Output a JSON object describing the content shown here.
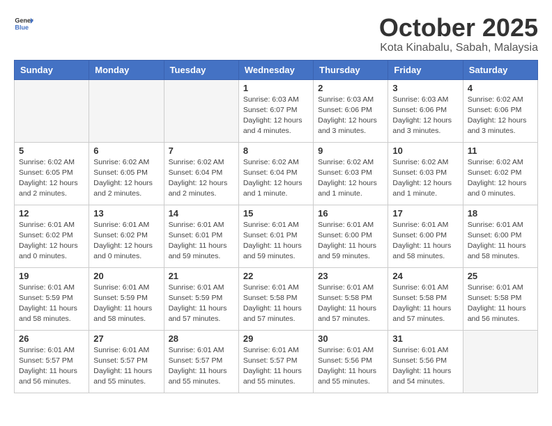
{
  "header": {
    "logo_general": "General",
    "logo_blue": "Blue",
    "month_title": "October 2025",
    "subtitle": "Kota Kinabalu, Sabah, Malaysia"
  },
  "weekdays": [
    "Sunday",
    "Monday",
    "Tuesday",
    "Wednesday",
    "Thursday",
    "Friday",
    "Saturday"
  ],
  "weeks": [
    [
      {
        "day": "",
        "info": ""
      },
      {
        "day": "",
        "info": ""
      },
      {
        "day": "",
        "info": ""
      },
      {
        "day": "1",
        "info": "Sunrise: 6:03 AM\nSunset: 6:07 PM\nDaylight: 12 hours\nand 4 minutes."
      },
      {
        "day": "2",
        "info": "Sunrise: 6:03 AM\nSunset: 6:06 PM\nDaylight: 12 hours\nand 3 minutes."
      },
      {
        "day": "3",
        "info": "Sunrise: 6:03 AM\nSunset: 6:06 PM\nDaylight: 12 hours\nand 3 minutes."
      },
      {
        "day": "4",
        "info": "Sunrise: 6:02 AM\nSunset: 6:06 PM\nDaylight: 12 hours\nand 3 minutes."
      }
    ],
    [
      {
        "day": "5",
        "info": "Sunrise: 6:02 AM\nSunset: 6:05 PM\nDaylight: 12 hours\nand 2 minutes."
      },
      {
        "day": "6",
        "info": "Sunrise: 6:02 AM\nSunset: 6:05 PM\nDaylight: 12 hours\nand 2 minutes."
      },
      {
        "day": "7",
        "info": "Sunrise: 6:02 AM\nSunset: 6:04 PM\nDaylight: 12 hours\nand 2 minutes."
      },
      {
        "day": "8",
        "info": "Sunrise: 6:02 AM\nSunset: 6:04 PM\nDaylight: 12 hours\nand 1 minute."
      },
      {
        "day": "9",
        "info": "Sunrise: 6:02 AM\nSunset: 6:03 PM\nDaylight: 12 hours\nand 1 minute."
      },
      {
        "day": "10",
        "info": "Sunrise: 6:02 AM\nSunset: 6:03 PM\nDaylight: 12 hours\nand 1 minute."
      },
      {
        "day": "11",
        "info": "Sunrise: 6:02 AM\nSunset: 6:02 PM\nDaylight: 12 hours\nand 0 minutes."
      }
    ],
    [
      {
        "day": "12",
        "info": "Sunrise: 6:01 AM\nSunset: 6:02 PM\nDaylight: 12 hours\nand 0 minutes."
      },
      {
        "day": "13",
        "info": "Sunrise: 6:01 AM\nSunset: 6:02 PM\nDaylight: 12 hours\nand 0 minutes."
      },
      {
        "day": "14",
        "info": "Sunrise: 6:01 AM\nSunset: 6:01 PM\nDaylight: 11 hours\nand 59 minutes."
      },
      {
        "day": "15",
        "info": "Sunrise: 6:01 AM\nSunset: 6:01 PM\nDaylight: 11 hours\nand 59 minutes."
      },
      {
        "day": "16",
        "info": "Sunrise: 6:01 AM\nSunset: 6:00 PM\nDaylight: 11 hours\nand 59 minutes."
      },
      {
        "day": "17",
        "info": "Sunrise: 6:01 AM\nSunset: 6:00 PM\nDaylight: 11 hours\nand 58 minutes."
      },
      {
        "day": "18",
        "info": "Sunrise: 6:01 AM\nSunset: 6:00 PM\nDaylight: 11 hours\nand 58 minutes."
      }
    ],
    [
      {
        "day": "19",
        "info": "Sunrise: 6:01 AM\nSunset: 5:59 PM\nDaylight: 11 hours\nand 58 minutes."
      },
      {
        "day": "20",
        "info": "Sunrise: 6:01 AM\nSunset: 5:59 PM\nDaylight: 11 hours\nand 58 minutes."
      },
      {
        "day": "21",
        "info": "Sunrise: 6:01 AM\nSunset: 5:59 PM\nDaylight: 11 hours\nand 57 minutes."
      },
      {
        "day": "22",
        "info": "Sunrise: 6:01 AM\nSunset: 5:58 PM\nDaylight: 11 hours\nand 57 minutes."
      },
      {
        "day": "23",
        "info": "Sunrise: 6:01 AM\nSunset: 5:58 PM\nDaylight: 11 hours\nand 57 minutes."
      },
      {
        "day": "24",
        "info": "Sunrise: 6:01 AM\nSunset: 5:58 PM\nDaylight: 11 hours\nand 57 minutes."
      },
      {
        "day": "25",
        "info": "Sunrise: 6:01 AM\nSunset: 5:58 PM\nDaylight: 11 hours\nand 56 minutes."
      }
    ],
    [
      {
        "day": "26",
        "info": "Sunrise: 6:01 AM\nSunset: 5:57 PM\nDaylight: 11 hours\nand 56 minutes."
      },
      {
        "day": "27",
        "info": "Sunrise: 6:01 AM\nSunset: 5:57 PM\nDaylight: 11 hours\nand 55 minutes."
      },
      {
        "day": "28",
        "info": "Sunrise: 6:01 AM\nSunset: 5:57 PM\nDaylight: 11 hours\nand 55 minutes."
      },
      {
        "day": "29",
        "info": "Sunrise: 6:01 AM\nSunset: 5:57 PM\nDaylight: 11 hours\nand 55 minutes."
      },
      {
        "day": "30",
        "info": "Sunrise: 6:01 AM\nSunset: 5:56 PM\nDaylight: 11 hours\nand 55 minutes."
      },
      {
        "day": "31",
        "info": "Sunrise: 6:01 AM\nSunset: 5:56 PM\nDaylight: 11 hours\nand 54 minutes."
      },
      {
        "day": "",
        "info": ""
      }
    ]
  ]
}
